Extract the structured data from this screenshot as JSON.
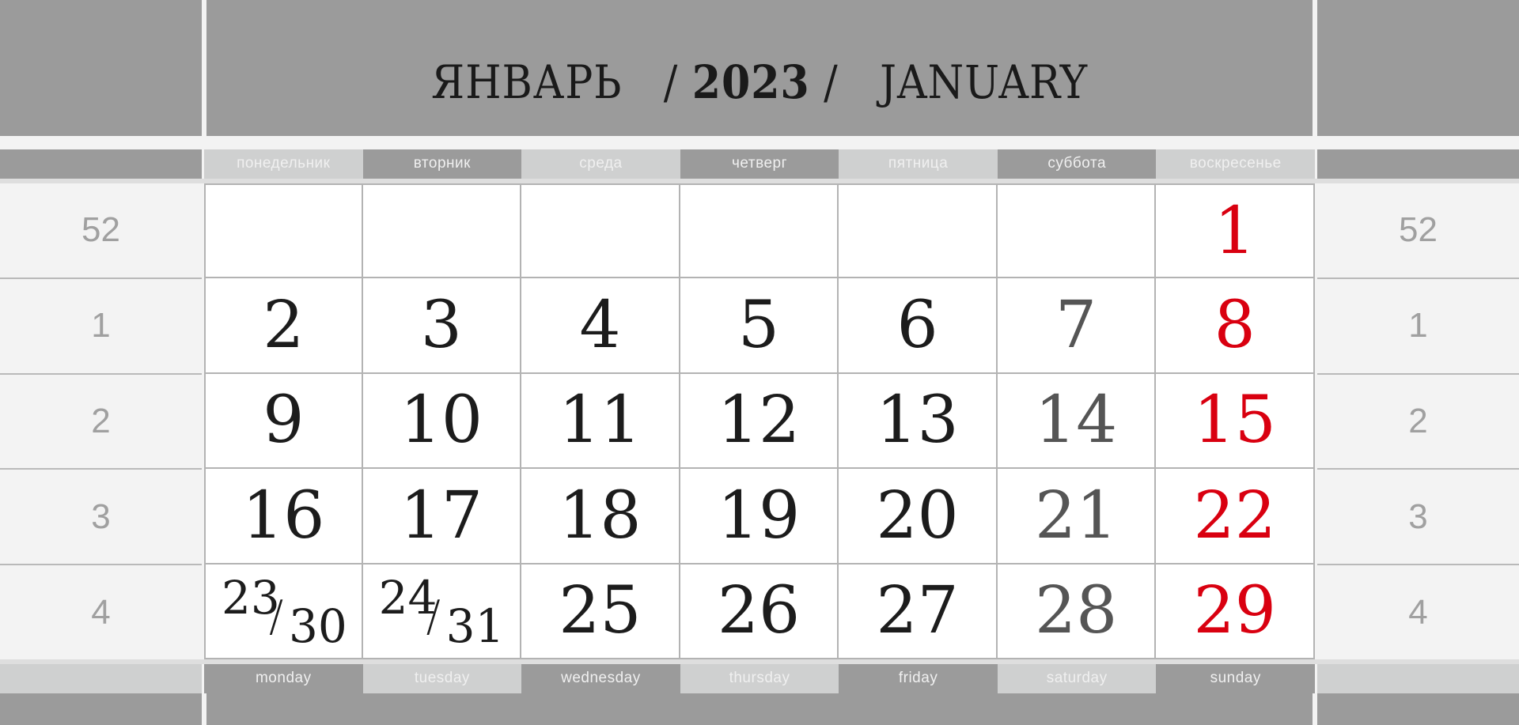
{
  "header": {
    "title_ru": "ЯНВАРЬ",
    "separator": "/",
    "year": "2023",
    "title_en": "JANUARY"
  },
  "weekdays_ru": [
    "понедельник",
    "вторник",
    "среда",
    "четверг",
    "пятница",
    "суббота",
    "воскресенье"
  ],
  "weekdays_en": [
    "monday",
    "tuesday",
    "wednesday",
    "thursday",
    "friday",
    "saturday",
    "sunday"
  ],
  "week_numbers": [
    "52",
    "1",
    "2",
    "3",
    "4"
  ],
  "weeks": [
    [
      "",
      "",
      "",
      "",
      "",
      "",
      "1"
    ],
    [
      "2",
      "3",
      "4",
      "5",
      "6",
      "7",
      "8"
    ],
    [
      "9",
      "10",
      "11",
      "12",
      "13",
      "14",
      "15"
    ],
    [
      "16",
      "17",
      "18",
      "19",
      "20",
      "21",
      "22"
    ],
    [
      "23/30",
      "24/31",
      "25",
      "26",
      "27",
      "28",
      "29"
    ]
  ],
  "colors": {
    "weekday_text": "#1c1c1c",
    "saturday_text": "#555555",
    "sunday_text": "#d90010",
    "band_dark": "#9b9b9b",
    "band_light": "#cfd0d0"
  }
}
